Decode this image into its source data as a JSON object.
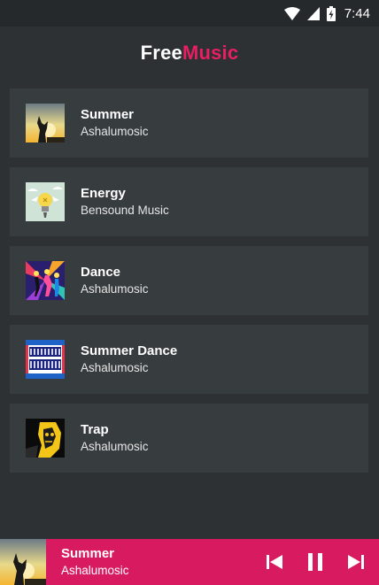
{
  "status_bar": {
    "time": "7:44",
    "icons": [
      "wifi-icon",
      "signal-icon",
      "battery-icon"
    ]
  },
  "app": {
    "logo_part1": "Free",
    "logo_part2": "Music",
    "colors": {
      "background": "#2d3133",
      "card": "#373c3e",
      "accent": "#e91e63",
      "player": "#d81b60"
    }
  },
  "songs": [
    {
      "title": "Summer",
      "artist": "Ashalumosic",
      "art": "summer-art"
    },
    {
      "title": "Energy",
      "artist": "Bensound Music",
      "art": "energy-art"
    },
    {
      "title": "Dance",
      "artist": "Ashalumosic",
      "art": "dance-art"
    },
    {
      "title": "Summer Dance",
      "artist": "Ashalumosic",
      "art": "summer-dance-art"
    },
    {
      "title": "Trap",
      "artist": "Ashalumosic",
      "art": "trap-art"
    }
  ],
  "now_playing": {
    "title": "Summer",
    "artist": "Ashalumosic",
    "controls": [
      "skip-previous-icon",
      "pause-icon",
      "skip-next-icon"
    ]
  }
}
